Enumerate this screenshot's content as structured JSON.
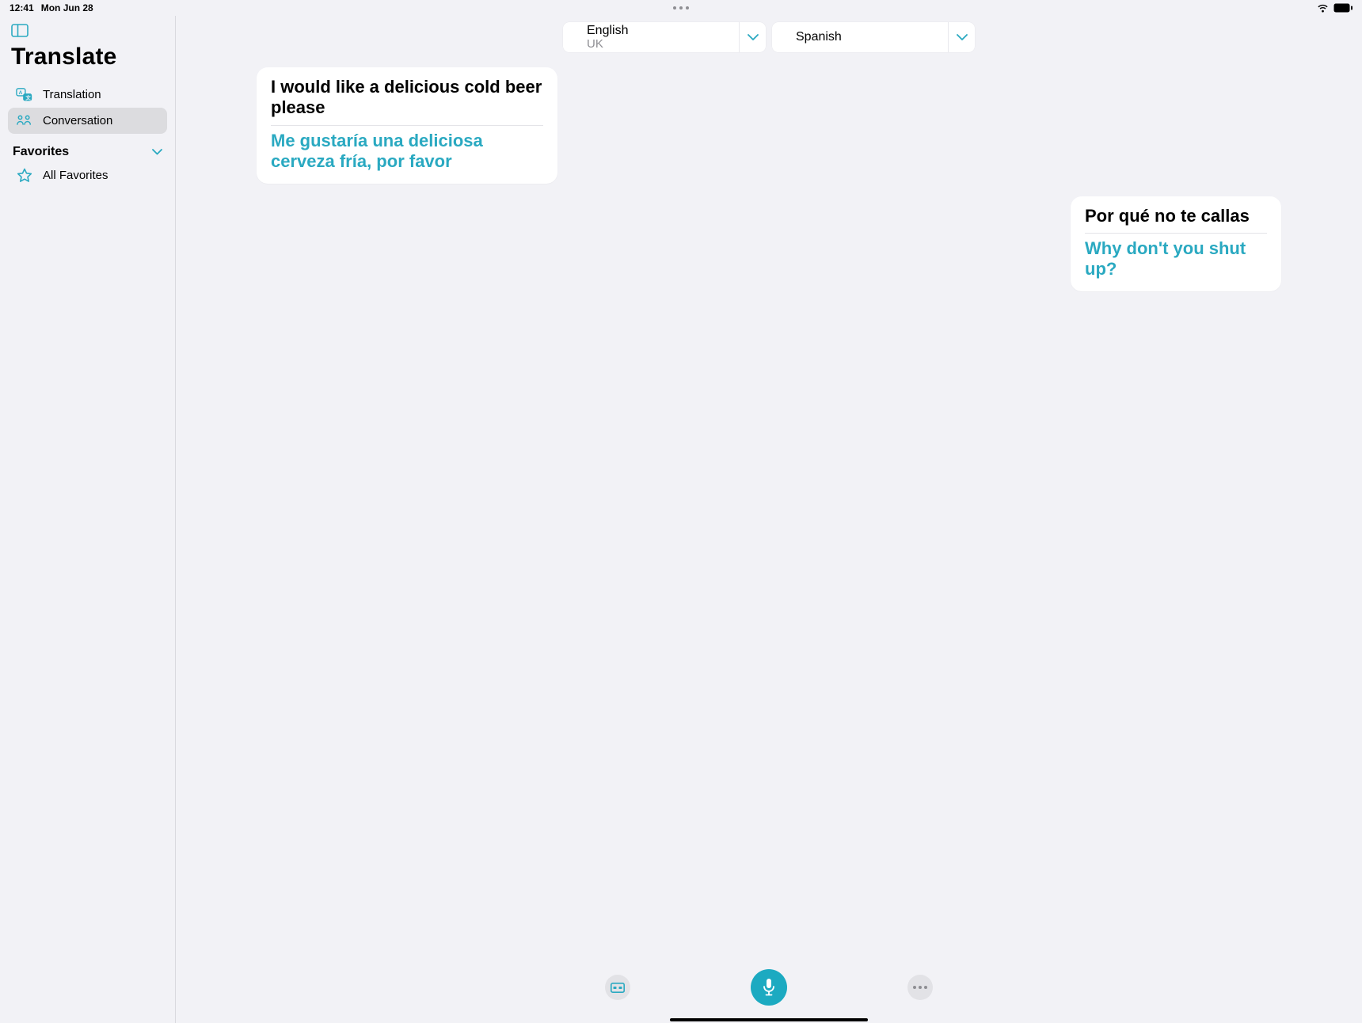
{
  "status": {
    "time": "12:41",
    "date": "Mon Jun 28"
  },
  "sidebar": {
    "title": "Translate",
    "items": [
      {
        "label": "Translation"
      },
      {
        "label": "Conversation"
      }
    ],
    "favorites_header": "Favorites",
    "all_favorites": "All Favorites"
  },
  "lang": {
    "source": {
      "name": "English",
      "region": "UK"
    },
    "target": {
      "name": "Spanish"
    }
  },
  "messages": [
    {
      "side": "left",
      "source": "I would like a delicious cold beer please",
      "translation": "Me gustaría una deliciosa cerveza fría, por favor"
    },
    {
      "side": "right",
      "source": "Por qué no te callas",
      "translation": "Why don't you shut up?"
    }
  ],
  "colors": {
    "accent": "#2aa9c1"
  }
}
